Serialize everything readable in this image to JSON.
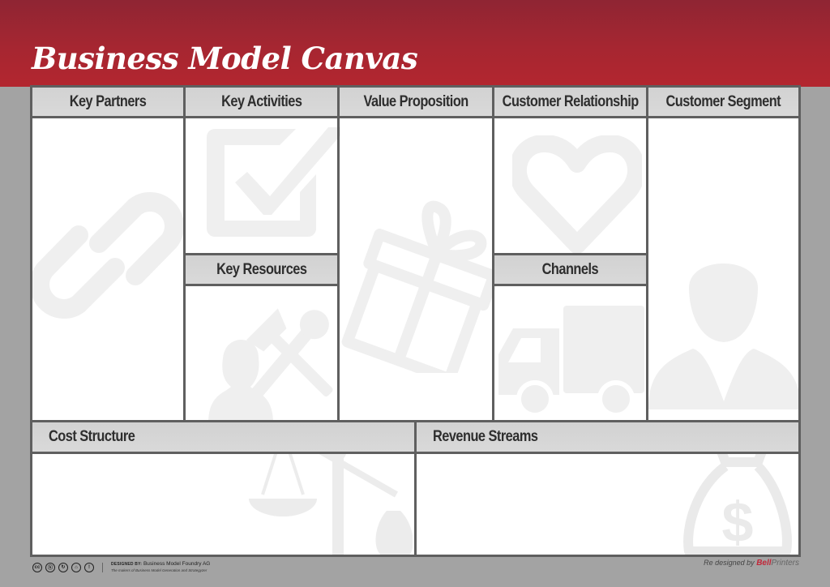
{
  "header": {
    "title": "Business Model Canvas"
  },
  "blocks": {
    "key_partners": {
      "label": "Key Partners",
      "icon": "link-icon"
    },
    "key_activities": {
      "label": "Key Activities",
      "icon": "checkbox-icon"
    },
    "key_resources": {
      "label": "Key Resources",
      "icon": "tools-person-icon"
    },
    "value_proposition": {
      "label": "Value Proposition",
      "icon": "gift-icon"
    },
    "customer_relationship": {
      "label": "Customer Relationship",
      "icon": "heart-icon"
    },
    "channels": {
      "label": "Channels",
      "icon": "truck-icon"
    },
    "customer_segment": {
      "label": "Customer Segment",
      "icon": "businessman-icon"
    },
    "cost_structure": {
      "label": "Cost Structure",
      "icon": "scale-icon"
    },
    "revenue_streams": {
      "label": "Revenue Streams",
      "icon": "money-bag-icon"
    }
  },
  "footer": {
    "license_icons": [
      "cc",
      "by",
      "sa",
      "nc",
      "person"
    ],
    "designed_by_label": "DESIGNED BY:",
    "designed_by_name": "Business Model Foundry AG",
    "tagline": "The makers of Business Model Generation and Strategyzer",
    "redesigned_prefix": "Re designed by",
    "brand_bell": "Bell",
    "brand_printers": "Printers"
  },
  "colors": {
    "banner": "#a62631",
    "background": "#a3a3a3",
    "border": "#5f5f5f",
    "header_fill": "#d4d4d4",
    "watermark": "#efefef",
    "brand_red": "#c0283a"
  }
}
